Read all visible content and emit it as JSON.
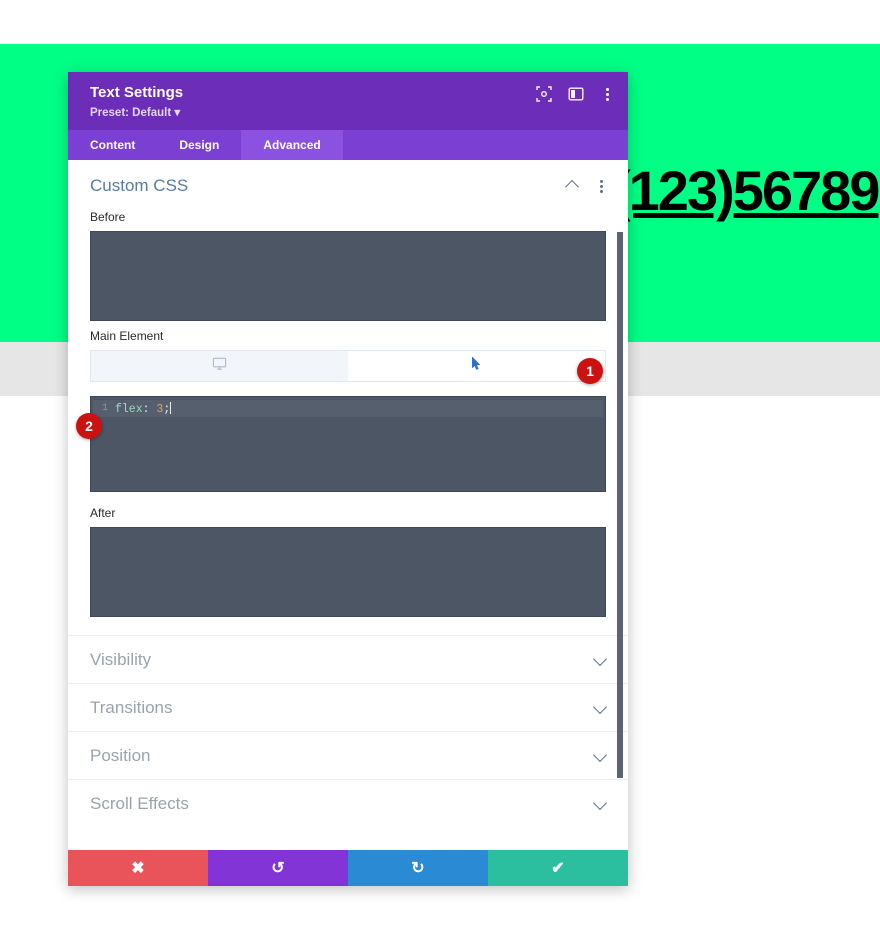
{
  "page": {
    "background_color": "#ffffff",
    "green_band_color": "#00FF85",
    "gray_band_color": "#e6e6e6",
    "phone_number": "(123)56789"
  },
  "modal": {
    "title": "Text Settings",
    "preset": "Preset: Default ▾",
    "header_color": "#6C2EB9",
    "header_icons": [
      {
        "name": "focus-target-icon"
      },
      {
        "name": "split-panel-icon"
      },
      {
        "name": "more-options-icon"
      }
    ],
    "tabs": [
      {
        "label": "Content",
        "active": false
      },
      {
        "label": "Design",
        "active": false
      },
      {
        "label": "Advanced",
        "active": true
      }
    ],
    "section": {
      "title": "Custom CSS",
      "collapse_icon": "chevron-up-icon",
      "menu_icon": "more-options-icon"
    },
    "fields": {
      "before_label": "Before",
      "main_element_label": "Main Element",
      "after_label": "After"
    },
    "element_tabs": [
      {
        "name": "desktop-view-tab",
        "icon": "monitor-icon",
        "active": false
      },
      {
        "name": "hover-state-tab",
        "icon": "cursor-pointer-icon",
        "active": true
      }
    ],
    "editor": {
      "line_number": "1",
      "property": "flex",
      "colon": ": ",
      "value": "3",
      "semicolon": ";"
    },
    "collapsed_sections": [
      {
        "label": "Visibility",
        "icon": "chevron-down-icon"
      },
      {
        "label": "Transitions",
        "icon": "chevron-down-icon"
      },
      {
        "label": "Position",
        "icon": "chevron-down-icon"
      },
      {
        "label": "Scroll Effects",
        "icon": "chevron-down-icon"
      }
    ],
    "footer_buttons": [
      {
        "name": "cancel-button",
        "icon": "close-x-icon",
        "glyph": "✖",
        "color": "#E8545A"
      },
      {
        "name": "undo-button",
        "icon": "undo-icon",
        "glyph": "↺",
        "color": "#8334D6"
      },
      {
        "name": "redo-button",
        "icon": "redo-icon",
        "glyph": "↻",
        "color": "#2A8AD4"
      },
      {
        "name": "save-button",
        "icon": "checkmark-icon",
        "glyph": "✔",
        "color": "#2BBFA0"
      }
    ]
  },
  "annotations": [
    {
      "id": "1",
      "label": "1"
    },
    {
      "id": "2",
      "label": "2"
    }
  ]
}
